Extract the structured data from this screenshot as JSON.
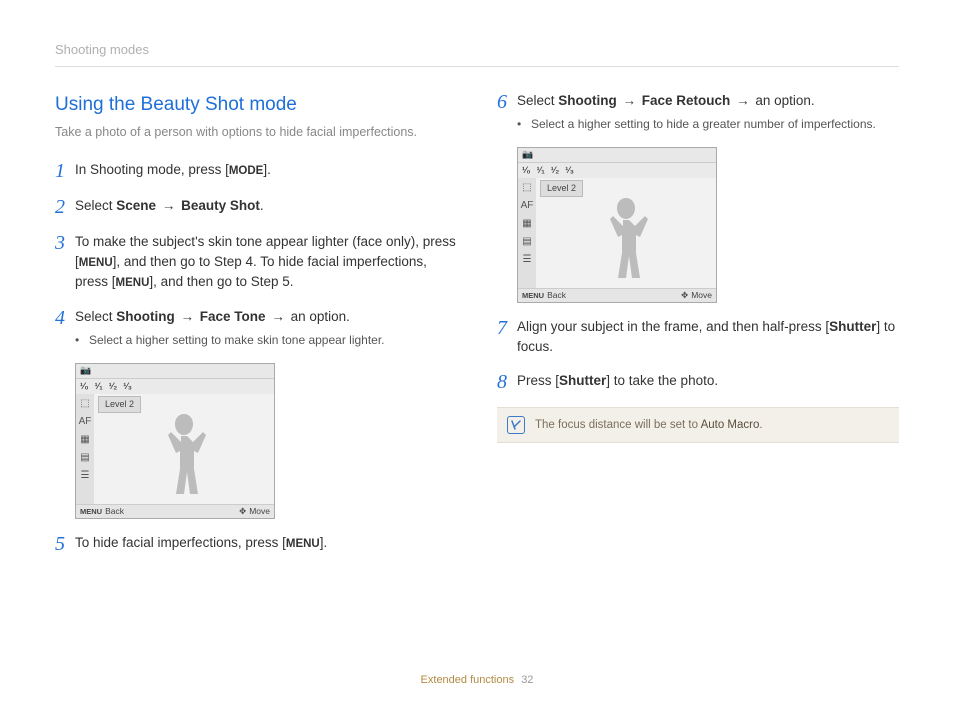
{
  "header": {
    "breadcrumb": "Shooting modes"
  },
  "left": {
    "title": "Using the Beauty Shot mode",
    "desc": "Take a photo of a person with options to hide facial imperfections.",
    "step1": {
      "num": "1",
      "pre": "In Shooting mode, press [",
      "key": "MODE",
      "post": "]."
    },
    "step2": {
      "num": "2",
      "pre": "Select ",
      "b1": "Scene",
      "arrow": " → ",
      "b2": "Beauty Shot",
      "post": "."
    },
    "step3": {
      "num": "3",
      "t1": "To make the subject's skin tone appear lighter (face only), press [",
      "k1": "MENU",
      "t2": "], and then go to Step 4. To hide facial imperfections, press [",
      "k2": "MENU",
      "t3": "], and then go to Step 5."
    },
    "step4": {
      "num": "4",
      "pre": "Select ",
      "b1": "Shooting",
      "arr1": " → ",
      "b2": "Face Tone",
      "arr2": " → ",
      "post": "an option.",
      "bullet": "Select a higher setting to make skin tone appear lighter."
    },
    "step5": {
      "num": "5",
      "pre": "To hide facial imperfections, press [",
      "key": "MENU",
      "post": "]."
    }
  },
  "right": {
    "step6": {
      "num": "6",
      "pre": "Select ",
      "b1": "Shooting",
      "arr1": " → ",
      "b2": "Face Retouch",
      "arr2": " → ",
      "post": "an option.",
      "bullet": "Select a higher setting to hide a greater number of imperfections."
    },
    "step7": {
      "num": "7",
      "t1": "Align your subject in the frame, and then half-press [",
      "b1": "Shutter",
      "t2": "] to focus."
    },
    "step8": {
      "num": "8",
      "t1": "Press [",
      "b1": "Shutter",
      "t2": "] to take the photo."
    },
    "note": {
      "t1": "The focus distance will be set to ",
      "b1": "Auto Macro",
      "t2": "."
    }
  },
  "lcd": {
    "level": "Level 2",
    "back_key": "MENU",
    "back": "Back",
    "move": "Move"
  },
  "footer": {
    "section": "Extended functions",
    "page": "32"
  }
}
